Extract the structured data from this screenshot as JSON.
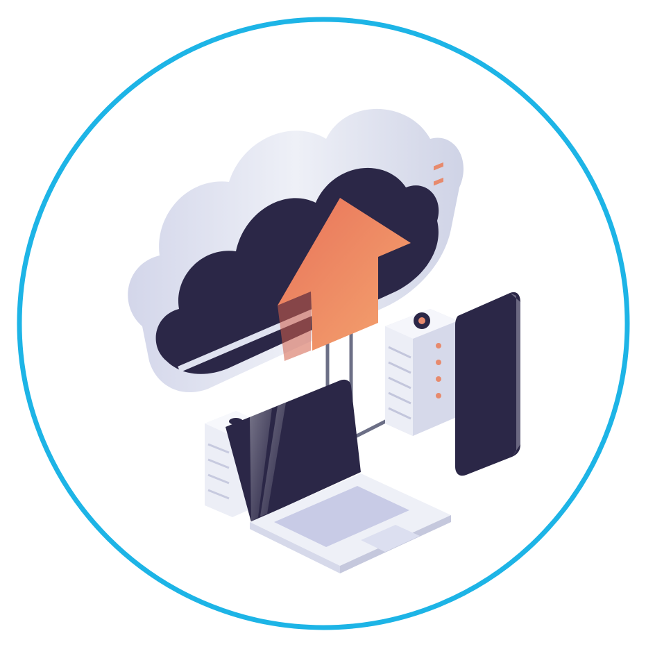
{
  "illustration": {
    "subject": "cloud-upload-icon",
    "elements": [
      "cloud-icon",
      "upload-arrow-icon",
      "server-rack-icon",
      "mobile-device-icon",
      "laptop-icon",
      "storage-unit-icon"
    ]
  },
  "colors": {
    "ring": "#1db4e6",
    "background": "#ffffff",
    "dark_navy": "#2b2747",
    "cloud_light": "#e6e8f2",
    "cloud_shade": "#c9cde3",
    "arrow_top": "#e8735a",
    "arrow_bottom": "#f3a272",
    "server_body": "#eceef6",
    "server_stripe": "#e78a6d",
    "laptop_screen": "#2b2747",
    "laptop_keyboard": "#c8cbe6",
    "connector": "#6c6f86"
  }
}
